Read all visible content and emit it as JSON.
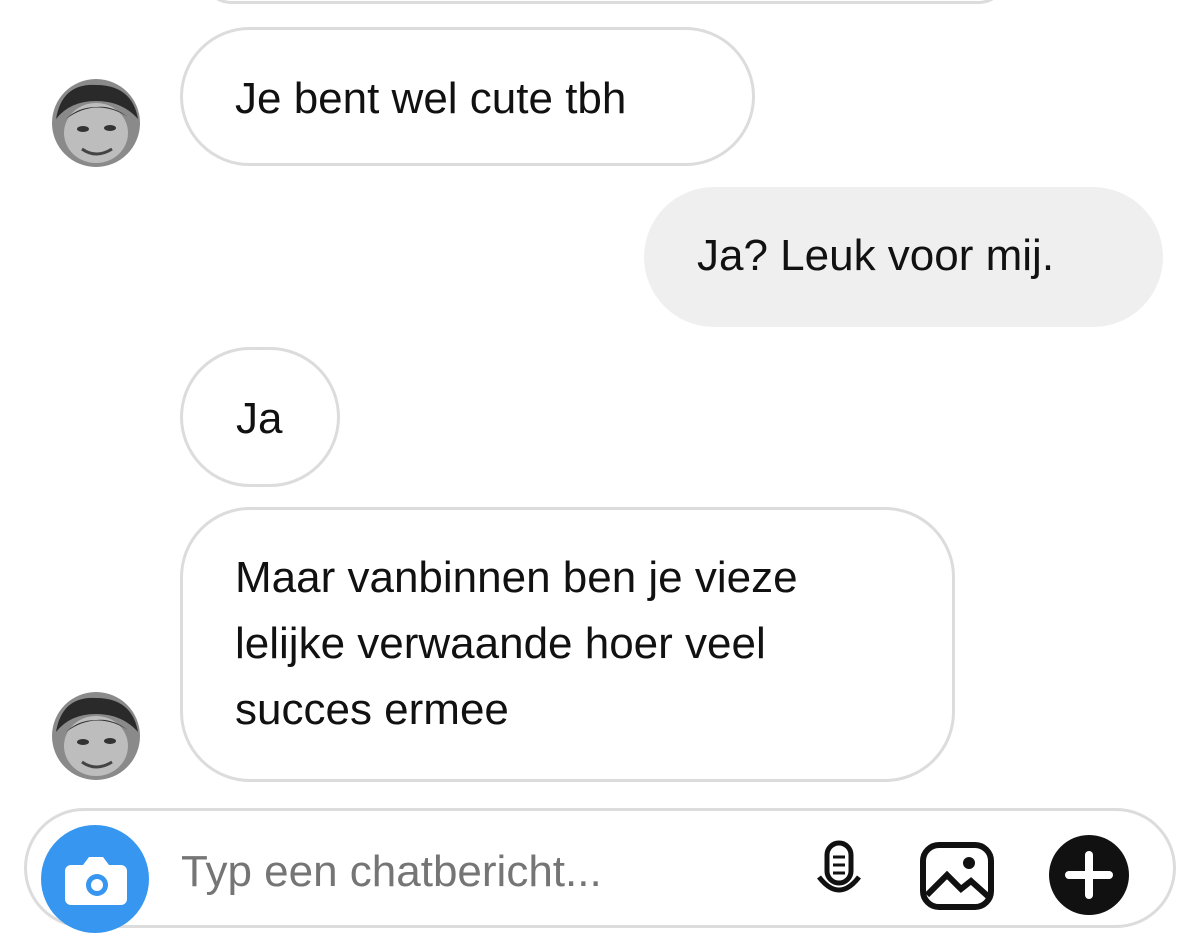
{
  "messages": [
    {
      "id": "m1",
      "direction": "received",
      "text": "Je bent wel cute tbh",
      "show_avatar": true
    },
    {
      "id": "m2",
      "direction": "sent",
      "text": "Ja? Leuk voor mij.",
      "show_avatar": false
    },
    {
      "id": "m3",
      "direction": "received",
      "text": "Ja",
      "show_avatar": false
    },
    {
      "id": "m4",
      "direction": "received",
      "lines": [
        "Maar vanbinnen ben je vieze",
        "lelijke verwaande hoer veel",
        "succes ermee"
      ],
      "show_avatar": true
    }
  ],
  "composer": {
    "placeholder": "Typ een chatbericht...",
    "icons": [
      "camera-icon",
      "microphone-icon",
      "gallery-icon",
      "add-icon"
    ]
  },
  "colors": {
    "camera_button": "#3797f0",
    "sent_bubble": "#efefef",
    "received_border": "#dcdcdc",
    "placeholder_text": "#9a9a9a"
  }
}
